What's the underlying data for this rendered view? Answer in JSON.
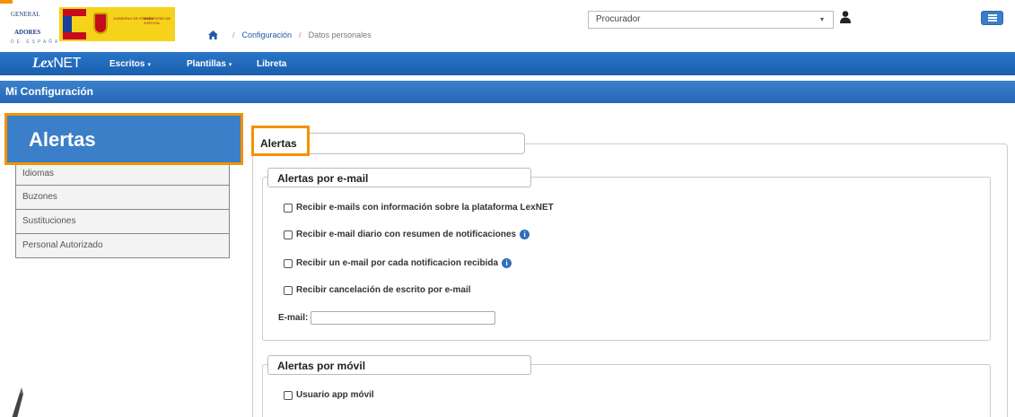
{
  "header": {
    "logo_left": {
      "line1": "GENERAL",
      "line2": "ADORES",
      "line3": "DE ESPAÑA"
    },
    "gov_banner": {
      "text1": "GOBIERNO DE ESPAÑA",
      "text2": "MINISTERIO DE JUSTICIA"
    },
    "breadcrumb": {
      "home_icon": "home-icon",
      "items": [
        "Configuración",
        "Datos personales"
      ]
    },
    "role_select": {
      "value": "Procurador"
    },
    "user_icon": "user-icon",
    "menu_icon": "hamburger-icon"
  },
  "navbar": {
    "brand_prefix": "Lex",
    "brand_suffix": "NET",
    "items": [
      {
        "label": "Escritos",
        "has_dropdown": true
      },
      {
        "label": "Plantillas",
        "has_dropdown": true
      },
      {
        "label": "Libreta",
        "has_dropdown": false
      }
    ]
  },
  "subbar": {
    "title": "Mi Configuración"
  },
  "sidebar": {
    "active": "Alertas",
    "items": [
      "Idiomas",
      "Buzones",
      "Sustituciones",
      "Personal Autorizado"
    ]
  },
  "main": {
    "legend": "Alertas",
    "email_section": {
      "legend": "Alertas por e-mail",
      "options": [
        {
          "label": "Recibir e-mails con información sobre la plataforma LexNET",
          "checked": false,
          "info": false
        },
        {
          "label": "Recibir e-mail diario con resumen de notificaciones",
          "checked": false,
          "info": true
        },
        {
          "label": "Recibir un e-mail por cada notificacion recibida",
          "checked": false,
          "info": true
        },
        {
          "label": "Recibir cancelación de escrito por e-mail",
          "checked": false,
          "info": false
        }
      ],
      "email_label": "E-mail:",
      "email_value": ""
    },
    "mobile_section": {
      "legend": "Alertas por móvil",
      "options": [
        {
          "label": "Usuario app móvil",
          "checked": false
        }
      ]
    }
  },
  "colors": {
    "primary": "#2a75c7",
    "highlight": "#f39200",
    "info": "#2f6fb7"
  }
}
